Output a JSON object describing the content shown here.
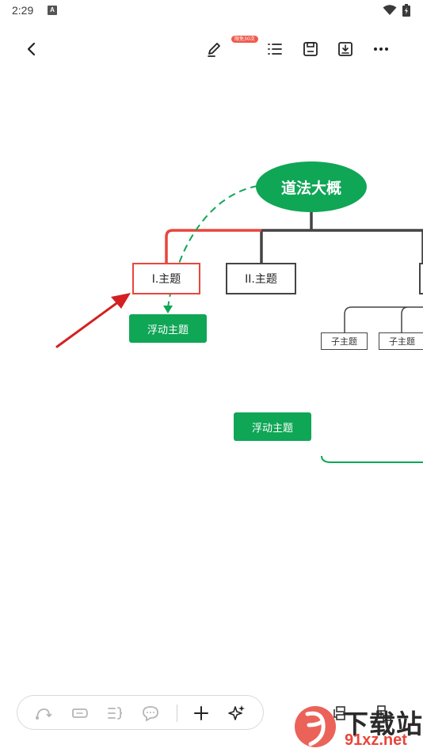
{
  "status_bar": {
    "time": "2:29",
    "indicator": "A"
  },
  "toolbar": {
    "badge": "限免30次"
  },
  "mindmap": {
    "root": "道法大概",
    "topics": [
      "I.主题",
      "II.主题"
    ],
    "subtopics": [
      "子主题",
      "子主题"
    ],
    "floating_topics": [
      "浮动主题",
      "浮动主题"
    ]
  },
  "colors": {
    "accent_green": "#0fa656",
    "highlight_red": "#e8463c",
    "line_dark": "#444444"
  },
  "watermark": {
    "text": "下载站",
    "url": "91xz.net"
  }
}
